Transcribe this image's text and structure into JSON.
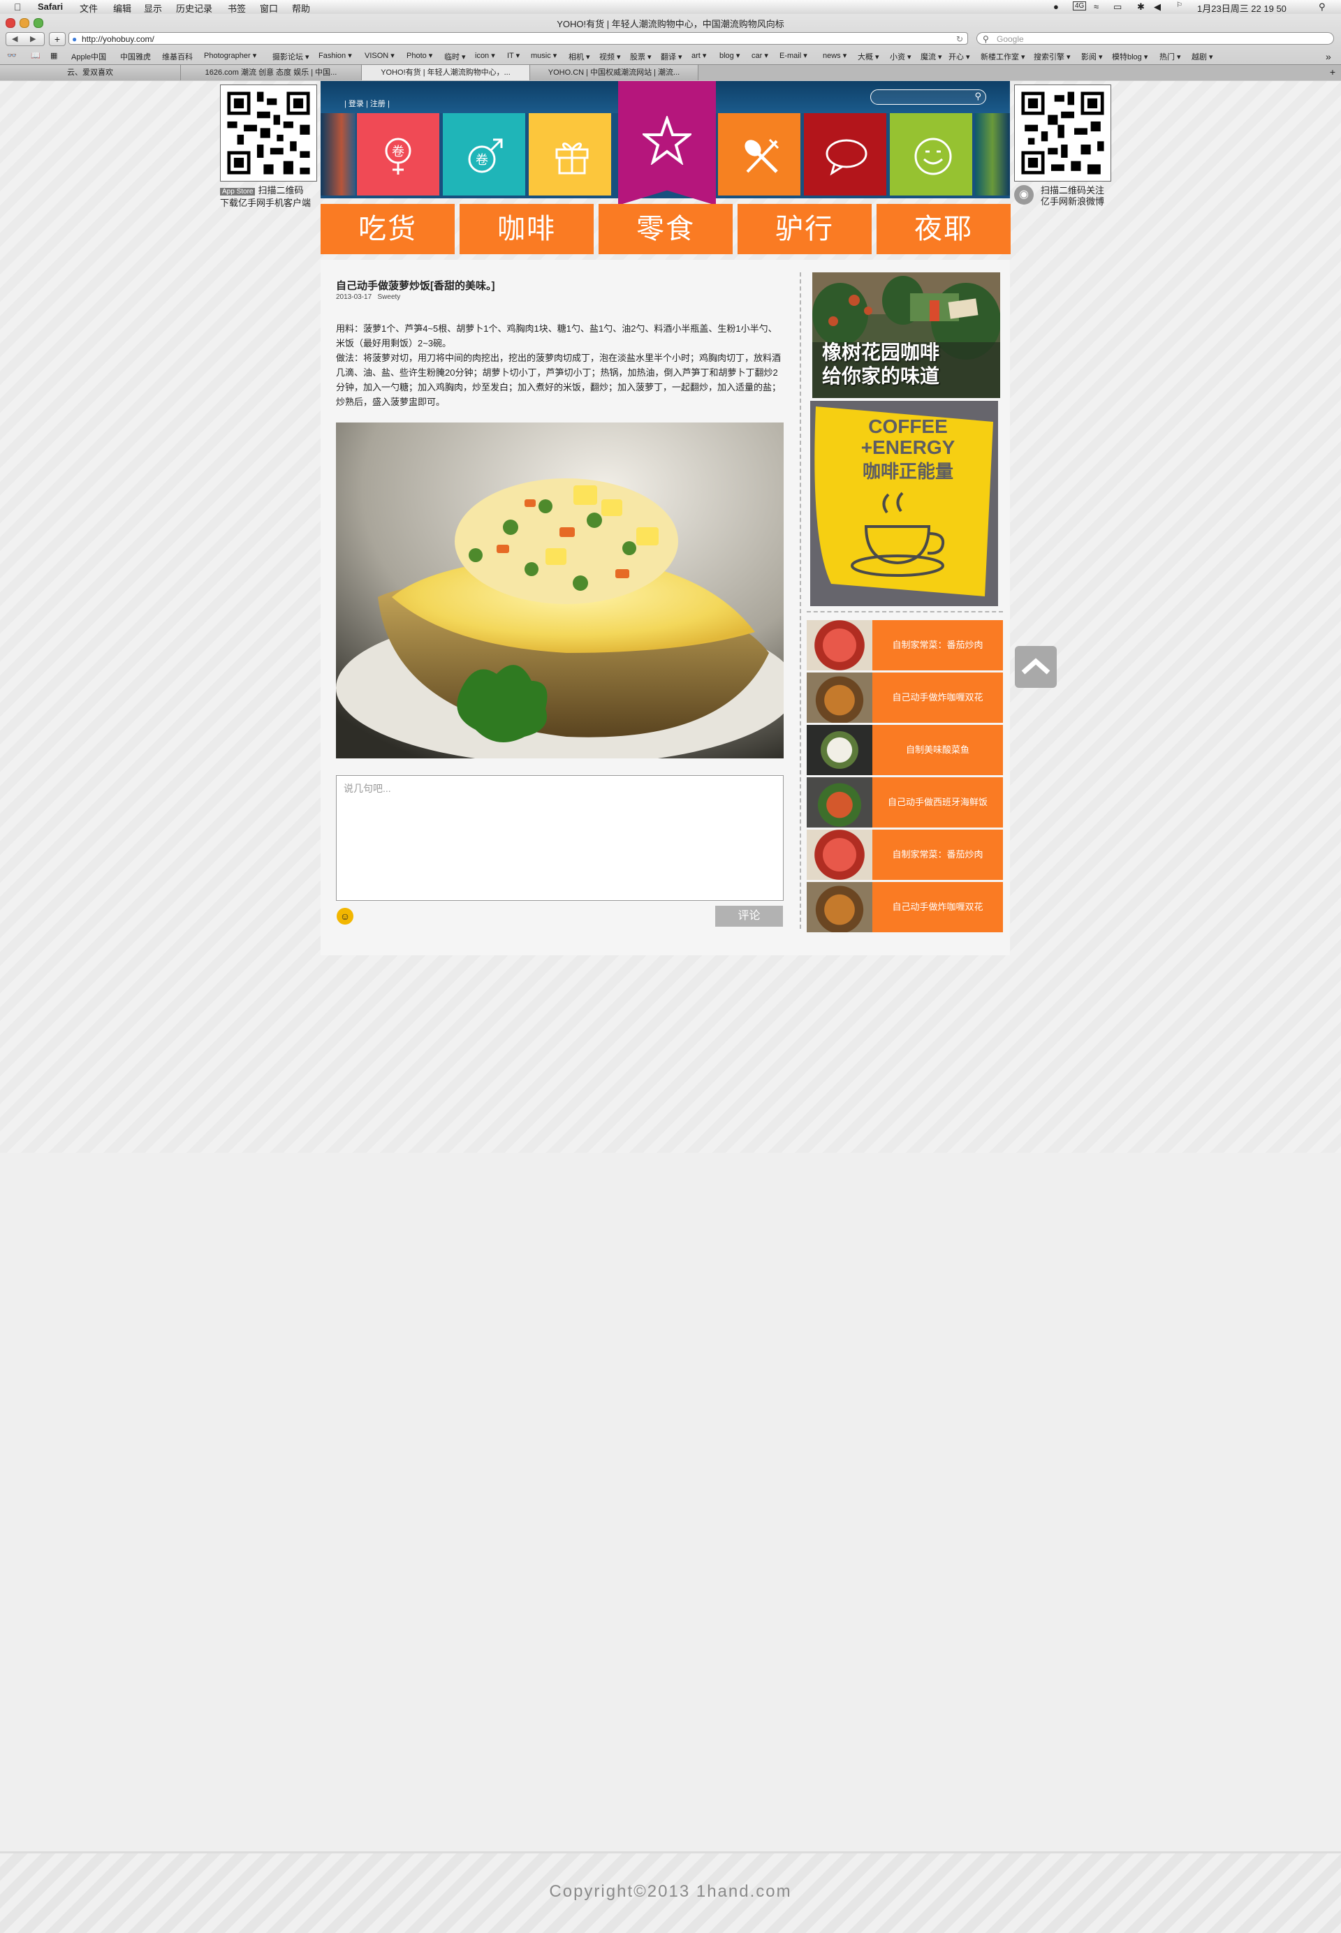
{
  "menubar": {
    "app": "Safari",
    "items": [
      "文件",
      "编辑",
      "显示",
      "历史记录",
      "书签",
      "窗口",
      "帮助"
    ],
    "clock": "1月23日周三  22 19 50"
  },
  "browser": {
    "title": "YOHO!有货 | 年轻人潮流购物中心，中国潮流购物风向标",
    "url": "http://yohobuy.com/",
    "search_placeholder": "Google",
    "bookmarks": [
      "Apple中国",
      "中国雅虎",
      "维基百科",
      "Photographer ▾",
      "摄影论坛 ▾",
      "Fashion ▾",
      "VISON ▾",
      "Photo ▾",
      "临时 ▾",
      "icon ▾",
      "IT ▾",
      "music ▾",
      "相机 ▾",
      "视频 ▾",
      "股票 ▾",
      "翻译 ▾",
      "art ▾",
      "blog ▾",
      "car ▾",
      "E-mail ▾",
      "news ▾",
      "大概 ▾",
      "小资 ▾",
      "魔流 ▾",
      "开心 ▾",
      "新楼工作室 ▾",
      "搜索引擎 ▾",
      "影阅 ▾",
      "模特blog ▾",
      "热门 ▾",
      "越剧 ▾"
    ],
    "tabs": [
      "云、爱双喜欢",
      "1626.com 潮流 创意 态度 娱乐 | 中国...",
      "YOHO!有货 | 年轻人潮流购物中心，...",
      "YOHO.CN | 中国权威潮流网站 | 潮流..."
    ]
  },
  "header": {
    "login": "登录",
    "register": "注册",
    "qr_left_caption": "扫描二维码",
    "qr_left_caption2": "下载亿手网手机客户端",
    "appstore": "App Store",
    "qr_right_caption": "扫描二维码关注",
    "qr_right_caption2": "亿手网新浪微博"
  },
  "icons": [
    {
      "name": "female-tag-icon",
      "color": "#f04a55"
    },
    {
      "name": "male-tag-icon",
      "color": "#1fb5b8"
    },
    {
      "name": "gift-icon",
      "color": "#fcc63c"
    },
    {
      "name": "star-icon",
      "color": "#b5167c"
    },
    {
      "name": "fork-spoon-icon",
      "color": "#f68121"
    },
    {
      "name": "speech-bubble-icon",
      "color": "#b3151b"
    },
    {
      "name": "smiley-icon",
      "color": "#96c231"
    }
  ],
  "categories": [
    "吃货",
    "咖啡",
    "零食",
    "驴行",
    "夜耶"
  ],
  "article": {
    "title": "自己动手做菠萝炒饭[香甜的美味。]",
    "date": "2013-03-17",
    "author": "Sweety",
    "ingredients": "用料：菠萝1个、芦笋4~5根、胡萝卜1个、鸡胸肉1块、糖1勺、盐1勺、油2勺、料酒小半瓶盖、生粉1小半勺、米饭（最好用剩饭）2~3碗。",
    "method": "做法：将菠萝对切，用刀将中间的肉挖出，挖出的菠萝肉切成丁，泡在淡盐水里半个小时；鸡胸肉切丁，放料酒几滴、油、盐、些许生粉腌20分钟；胡萝卜切小丁，芦笋切小丁；热锅，加热油，倒入芦笋丁和胡萝卜丁翻炒2分钟，加入一勺糖；加入鸡胸肉，炒至发白；加入煮好的米饭，翻炒；加入菠萝丁，一起翻炒，加入适量的盐；炒熟后，盛入菠萝盅即可。"
  },
  "comment": {
    "placeholder": "说几句吧...",
    "submit": "评论"
  },
  "ads": {
    "ad1_line1": "橡树花园咖啡",
    "ad1_line2": "给你家的味道",
    "ad2_line1": "COFFEE",
    "ad2_line2": "+ENERGY",
    "ad2_line3": "咖啡正能量"
  },
  "recommendations": [
    "自制家常菜：番茄炒肉",
    "自己动手做炸咖喱双花",
    "自制美味酸菜鱼",
    "自己动手做西班牙海鲜饭",
    "自制家常菜：番茄炒肉",
    "自己动手做炸咖喱双花"
  ],
  "footer": {
    "copyright": "Copyright©2013 1hand.com"
  }
}
